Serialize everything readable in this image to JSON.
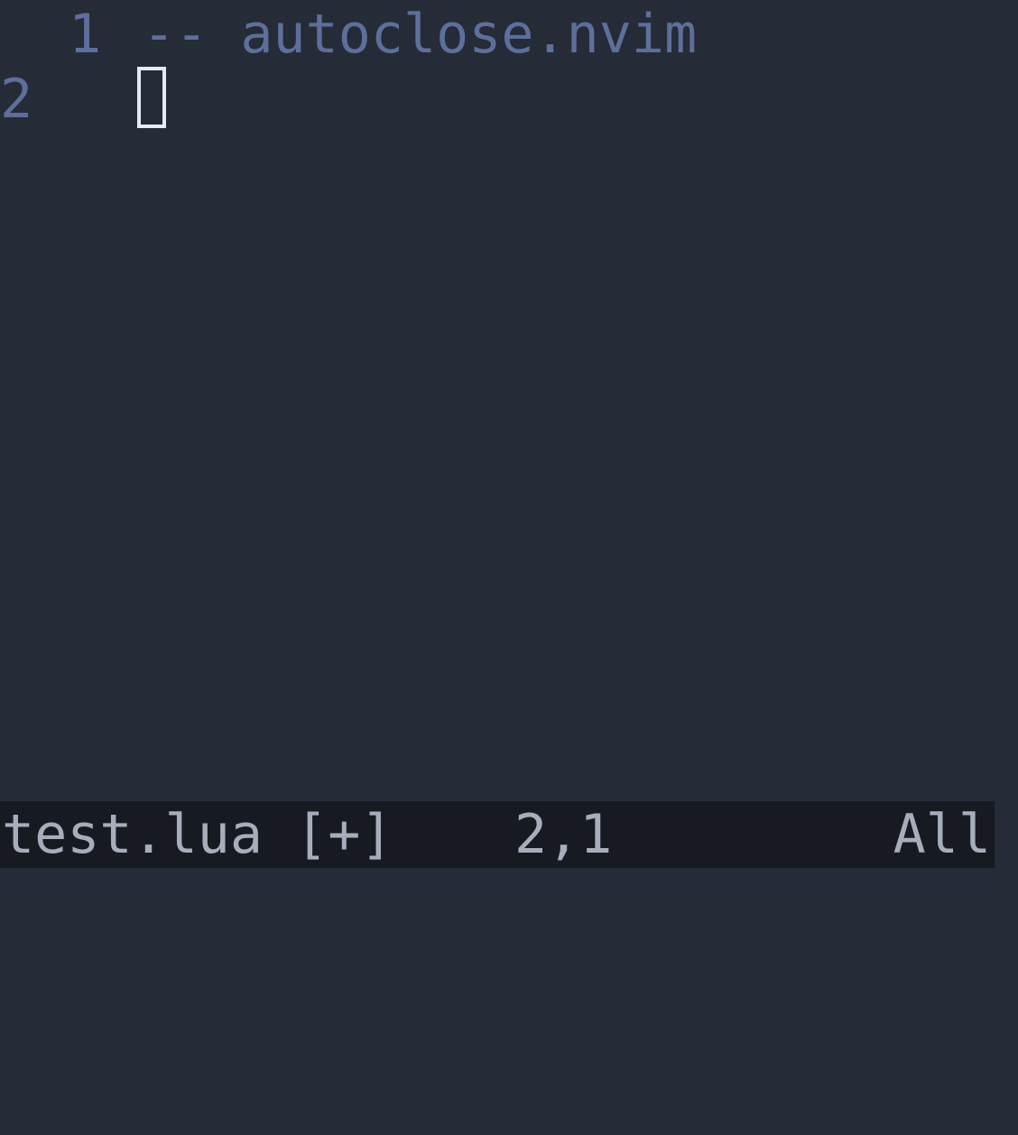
{
  "editor": {
    "lines": [
      {
        "number": "1",
        "text": "-- autoclose.nvim"
      },
      {
        "number": "2",
        "text": ""
      }
    ],
    "colors": {
      "background": "#252b37",
      "line_number": "#5d6f9a",
      "comment": "#5d6f9a",
      "cursor": "#e8eaf2"
    }
  },
  "statusline": {
    "file": "test.lua [+]",
    "position": "2,1",
    "scroll": "All",
    "colors": {
      "background": "#171b21",
      "text": "#a7adba"
    }
  }
}
